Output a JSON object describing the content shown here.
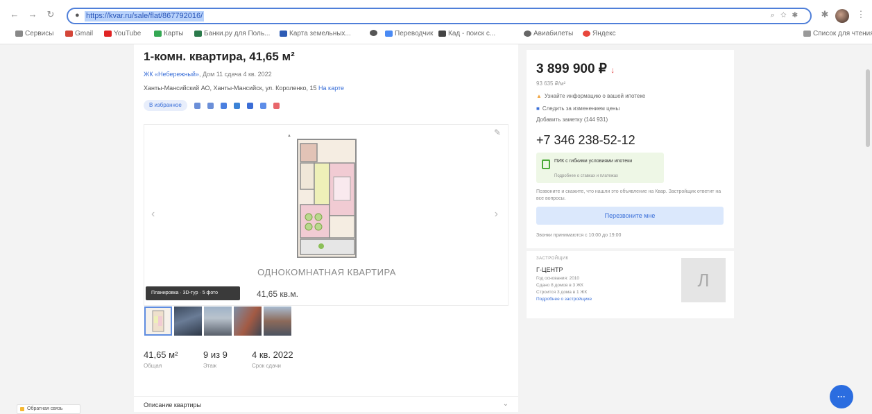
{
  "browser": {
    "url": "https://kvar.ru/sale/flat/867792016/",
    "bookmarks": [
      {
        "label": "Сервисы",
        "color": "#888888"
      },
      {
        "label": "Gmail",
        "color": "#d44638"
      },
      {
        "label": "YouTube",
        "color": "#e02424"
      },
      {
        "label": "Карты",
        "color": "#34a853"
      },
      {
        "label": "Банки.ру для Поль...",
        "color": "#2b7a4b"
      },
      {
        "label": "Карта земельных...",
        "color": "#2d5bb5"
      },
      {
        "label": "",
        "color": "#555555"
      },
      {
        "label": "Переводчик",
        "color": "#4a8af4"
      },
      {
        "label": "Кад - поиск с...",
        "color": "#444444"
      },
      {
        "label": "Авиабилеты",
        "color": "#666666"
      },
      {
        "label": "Яндекс",
        "color": "#e8473c"
      }
    ],
    "reading_list": "Список для чтения"
  },
  "listing": {
    "title": "1-комн. квартира, 41,65 м²",
    "complex_link": "ЖК «Небережный»",
    "complex_meta": "Дом 11 сдача 4 кв. 2022",
    "address": "Ханты-Мансийский АО, Ханты-Мансийск, ул. Короленко, 15",
    "address_link": "На карте",
    "favorite_label": "В избранное",
    "plan_caption": "ОДНОКОМНАТНАЯ КВАРТИРА",
    "area_label": "41,65 кв.м.",
    "tour_badge": "Планировка · 3D-тур · 5 фото",
    "stats": [
      {
        "value": "41,65 м²",
        "label": "Общая"
      },
      {
        "value": "9 из 9",
        "label": "Этаж"
      },
      {
        "value": "4 кв. 2022",
        "label": "Срок сдачи"
      }
    ],
    "description_title": "Описание квартиры"
  },
  "pricing": {
    "price": "3 899 900 ₽",
    "price_per_m2": "93 635 ₽/м²",
    "note_mortgage": "Узнайте информацию о вашей ипотеке",
    "note_help": "Следить за изменением цены",
    "note_contact": "Добавить заметку (144 931)",
    "phone": "+7 346 238-52-12",
    "pay_title": "ПИК с гибкими условиями ипотеки",
    "pay_sub": "Подробнее о ставках и платежах",
    "disclaimer": "Позвоните и скажите, что нашли это объявление на Квар. Застройщик ответит на все вопросы.",
    "callback_label": "Перезвоните мне",
    "hours": "Звонки принимаются с 10:00 до 19:00"
  },
  "developer": {
    "heading": "ЗАСТРОЙЩИК",
    "name": "Г-ЦЕНТР",
    "info": [
      "Год основания: 2010",
      "Сдано 8 домов в 3 ЖК",
      "Строится 3 дома в 1 ЖК",
      "Подробнее о застройщике"
    ],
    "logo_letter": "Л"
  },
  "widgets": {
    "chat": "···",
    "feedback": "Обратная связь"
  }
}
